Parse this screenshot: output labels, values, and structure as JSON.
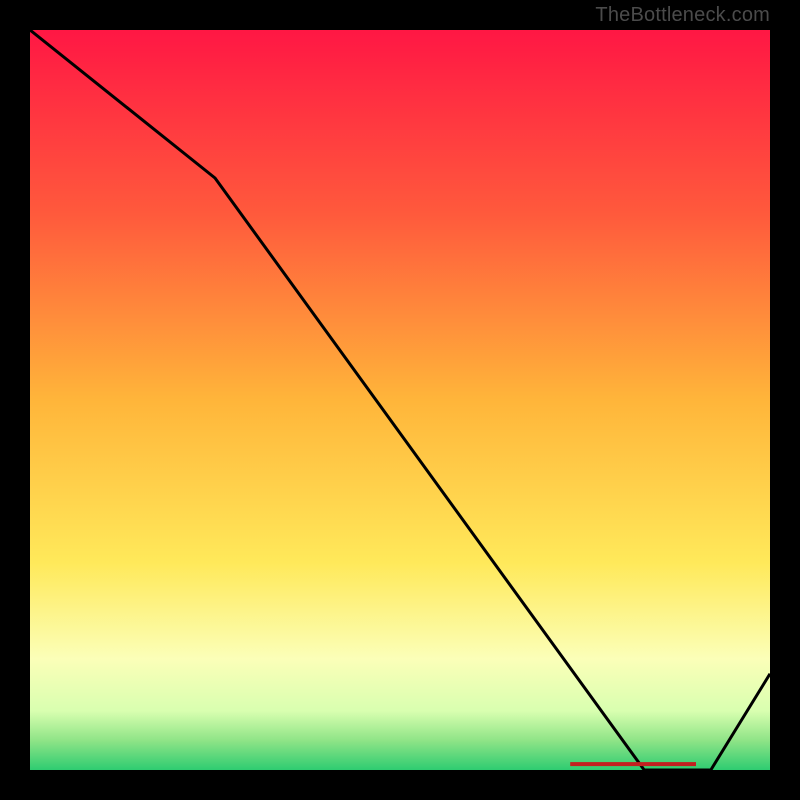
{
  "attribution": "TheBottleneck.com",
  "red_marker_text": "",
  "chart_data": {
    "type": "line",
    "title": "",
    "xlabel": "",
    "ylabel": "",
    "xlim": [
      0,
      100
    ],
    "ylim": [
      0,
      100
    ],
    "series": [
      {
        "name": "curve",
        "x": [
          0,
          25,
          83,
          92,
          100
        ],
        "y": [
          100,
          80,
          0,
          0,
          13
        ]
      }
    ],
    "gradient_stops": [
      {
        "offset": 0,
        "color": "#ff1744"
      },
      {
        "offset": 25,
        "color": "#ff5a3c"
      },
      {
        "offset": 50,
        "color": "#ffb53a"
      },
      {
        "offset": 72,
        "color": "#ffe95a"
      },
      {
        "offset": 85,
        "color": "#fbffb8"
      },
      {
        "offset": 92,
        "color": "#d9ffb0"
      },
      {
        "offset": 96,
        "color": "#8fe487"
      },
      {
        "offset": 100,
        "color": "#2ecc71"
      }
    ],
    "red_marker": {
      "x_start": 73,
      "x_end": 90,
      "y": 0.8
    }
  }
}
